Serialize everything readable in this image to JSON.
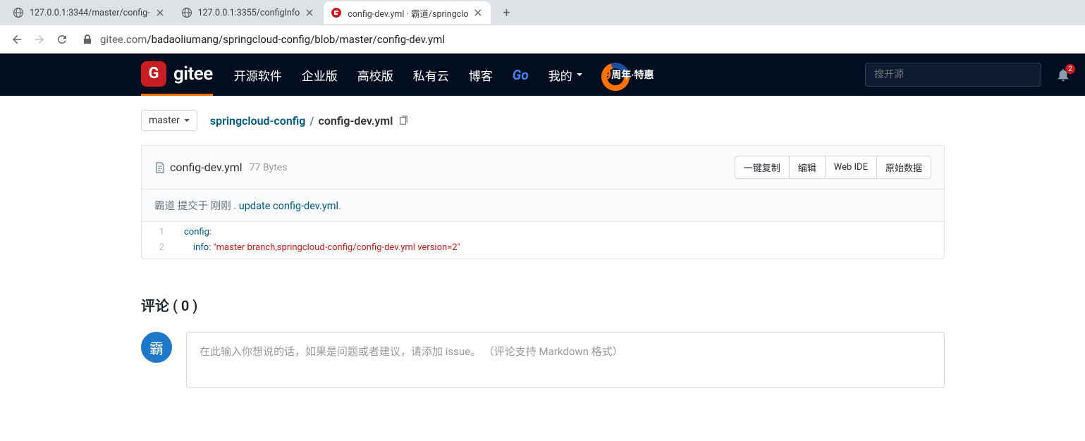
{
  "browser": {
    "tabs": [
      {
        "title": "127.0.0.1:3344/master/config-",
        "active": false,
        "favicon": "globe"
      },
      {
        "title": "127.0.0.1:3355/configInfo",
        "active": false,
        "favicon": "globe"
      },
      {
        "title": "config-dev.yml · 霸道/springclo",
        "active": true,
        "favicon": "gitee"
      }
    ],
    "url_host": "gitee.com",
    "url_path": "/badaoliumang/springcloud-config/blob/master/config-dev.yml"
  },
  "nav": {
    "logo_text": "gitee",
    "items": [
      "开源软件",
      "企业版",
      "高校版",
      "私有云",
      "博客"
    ],
    "go_label": "Go",
    "my_label": "我的",
    "promo_prefix": "9",
    "promo_text": "周年·特惠",
    "search_placeholder": "搜开源",
    "bell_count": "2"
  },
  "breadcrumb": {
    "branch": "master",
    "repo": "springcloud-config",
    "file": "config-dev.yml"
  },
  "file": {
    "name": "config-dev.yml",
    "size": "77 Bytes",
    "actions": [
      "一键复制",
      "编辑",
      "Web IDE",
      "原始数据"
    ],
    "commit_author": "霸道",
    "commit_verb": "提交于",
    "commit_time": "刚刚",
    "commit_msg": "update config-dev.yml",
    "commit_period": ".",
    "commit_sep": " . ",
    "lines": [
      {
        "no": "1",
        "indent": "",
        "key": "config",
        "punct": ":",
        "str": ""
      },
      {
        "no": "2",
        "indent": "    ",
        "key": "info",
        "punct": ": ",
        "str": "\"master branch,springcloud-config/config-dev.yml version=2\""
      }
    ]
  },
  "comments": {
    "header": "评论 ( 0 )",
    "avatar_char": "霸",
    "placeholder": "在此输入你想说的话，如果是问题或者建议，请添加 issue。  （评论支持 Markdown 格式）"
  }
}
